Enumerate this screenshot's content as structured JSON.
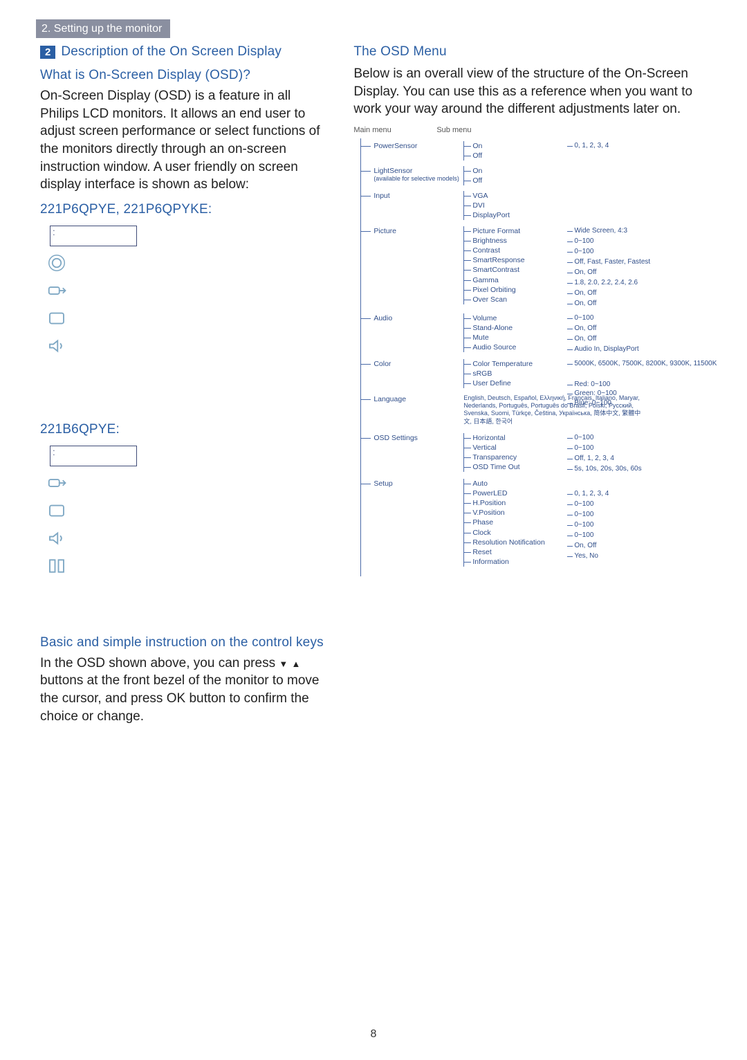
{
  "sectionTab": "2. Setting up the monitor",
  "left": {
    "num": "2",
    "heading": "Description of the On Screen Display",
    "sub1": "What is On-Screen Display (OSD)?",
    "p1": "On-Screen Display (OSD) is a feature in all Philips LCD monitors. It allows an end user to adjust screen performance or select functions of the monitors directly through an on-screen instruction window. A user friendly on screen display interface is shown as below:",
    "model1": "221P6QPYE, 221P6QPYKE:",
    "model2": "221B6QPYE:",
    "sub2": "Basic and simple instruction on the control keys",
    "p2a": "In the OSD shown above, you can press ",
    "p2b": " buttons at the front bezel of the monitor to move the cursor, and press OK button to confirm the choice or change."
  },
  "right": {
    "heading": "The OSD Menu",
    "p1": "Below is an overall view of the structure of the On-Screen Display. You can use this as a reference when you want to work your way around the different adjustments later on.",
    "mh1": "Main menu",
    "mh2": "Sub menu",
    "tree": [
      {
        "label": "PowerSensor",
        "sub": [
          "On",
          "Off"
        ],
        "vals": [
          {
            "i": 0,
            "t": "0, 1, 2, 3, 4"
          }
        ]
      },
      {
        "label": "LightSensor",
        "note": "(available for selective models)",
        "sub": [
          "On",
          "Off"
        ]
      },
      {
        "label": "Input",
        "sub": [
          "VGA",
          "DVI",
          "DisplayPort"
        ]
      },
      {
        "label": "Picture",
        "sub": [
          "Picture Format",
          "Brightness",
          "Contrast",
          "SmartResponse",
          "SmartContrast",
          "Gamma",
          "Pixel Orbiting",
          "Over Scan"
        ],
        "vals": [
          {
            "i": 0,
            "t": "Wide Screen, 4:3"
          },
          {
            "i": 1,
            "t": "0~100"
          },
          {
            "i": 2,
            "t": "0~100"
          },
          {
            "i": 3,
            "t": "Off, Fast, Faster, Fastest"
          },
          {
            "i": 4,
            "t": "On, Off"
          },
          {
            "i": 5,
            "t": "1.8, 2.0, 2.2, 2.4, 2.6"
          },
          {
            "i": 6,
            "t": "On, Off"
          },
          {
            "i": 7,
            "t": "On, Off"
          }
        ]
      },
      {
        "label": "Audio",
        "sub": [
          "Volume",
          "Stand-Alone",
          "Mute",
          "Audio Source"
        ],
        "vals": [
          {
            "i": 0,
            "t": "0~100"
          },
          {
            "i": 1,
            "t": "On, Off"
          },
          {
            "i": 2,
            "t": "On, Off"
          },
          {
            "i": 3,
            "t": "Audio In, DisplayPort"
          }
        ]
      },
      {
        "label": "Color",
        "sub": [
          "Color Temperature",
          "sRGB",
          "User Define"
        ],
        "vals": [
          {
            "i": 0,
            "t": "5000K, 6500K, 7500K, 8200K, 9300K, 11500K"
          },
          {
            "i": 2,
            "t": "Red: 0~100\nGreen: 0~100\nBlue: 0~100",
            "multi": true
          }
        ]
      },
      {
        "label": "Language",
        "langs": true
      },
      {
        "label": "OSD Settings",
        "sub": [
          "Horizontal",
          "Vertical",
          "Transparency",
          "OSD Time Out"
        ],
        "vals": [
          {
            "i": 0,
            "t": "0~100"
          },
          {
            "i": 1,
            "t": "0~100"
          },
          {
            "i": 2,
            "t": "Off, 1, 2, 3, 4"
          },
          {
            "i": 3,
            "t": "5s, 10s, 20s, 30s, 60s"
          }
        ]
      },
      {
        "label": "Setup",
        "sub": [
          "Auto",
          "PowerLED",
          "H.Position",
          "V.Position",
          "Phase",
          "Clock",
          "Resolution Notification",
          "Reset",
          "Information"
        ],
        "vals": [
          {
            "i": 1,
            "t": "0, 1, 2, 3, 4"
          },
          {
            "i": 2,
            "t": "0~100"
          },
          {
            "i": 3,
            "t": "0~100"
          },
          {
            "i": 4,
            "t": "0~100"
          },
          {
            "i": 5,
            "t": "0~100"
          },
          {
            "i": 6,
            "t": "On, Off"
          },
          {
            "i": 7,
            "t": "Yes, No"
          }
        ]
      }
    ],
    "languages": "English, Deutsch, Español, Ελληνική, Français, Italiano, Maryar, Nederlands, Português, Português do Brasil, Polski, Русский, Svenska, Suomi, Türkçe, Čeština, Українська, 简体中文, 繁體中文, 日本語, 한국어"
  },
  "pageNum": "8"
}
